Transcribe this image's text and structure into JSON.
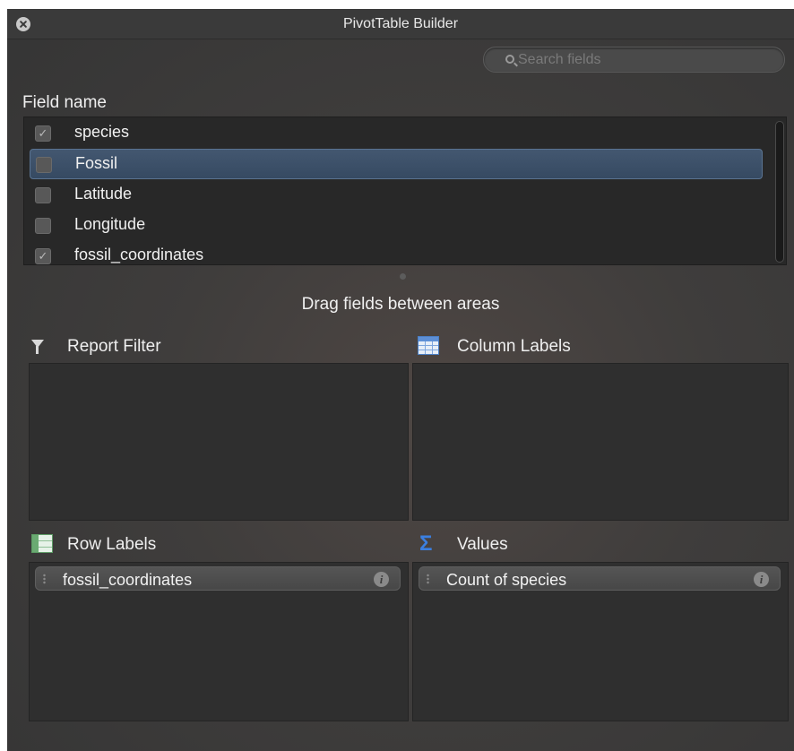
{
  "window": {
    "title": "PivotTable Builder"
  },
  "search": {
    "placeholder": "Search fields",
    "value": ""
  },
  "field_list": {
    "header": "Field name",
    "items": [
      {
        "label": "species",
        "checked": true
      },
      {
        "label": "Fossil",
        "checked": false,
        "selected": true
      },
      {
        "label": "Latitude",
        "checked": false
      },
      {
        "label": "Longitude",
        "checked": false
      },
      {
        "label": "fossil_coordinates",
        "checked": true
      }
    ],
    "check_glyph": "✓"
  },
  "drag_hint": "Drag fields between areas",
  "areas": {
    "report_filter": {
      "label": "Report Filter",
      "icon": "filter-icon",
      "fields": []
    },
    "column_labels": {
      "label": "Column Labels",
      "icon": "column-grid-icon",
      "fields": []
    },
    "row_labels": {
      "label": "Row Labels",
      "icon": "row-grid-icon",
      "fields": [
        "fossil_coordinates"
      ]
    },
    "values": {
      "label": "Values",
      "icon": "sigma-icon",
      "icon_glyph": "Σ",
      "fields": [
        "Count of species"
      ]
    }
  },
  "info_glyph": "i",
  "colors": {
    "selection": "#435770",
    "sigma": "#3b7fe0"
  }
}
